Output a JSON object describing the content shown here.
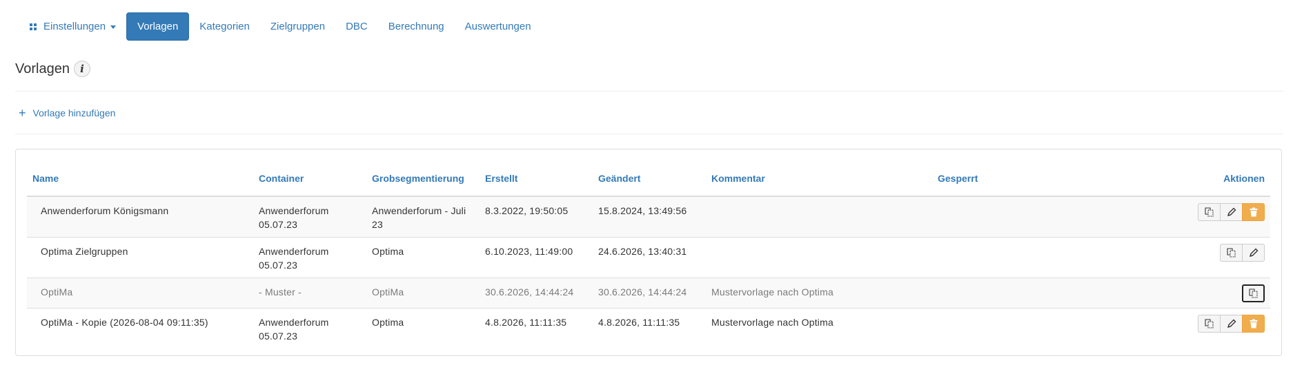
{
  "nav": {
    "settings_label": "Einstellungen",
    "tabs": [
      {
        "label": "Vorlagen",
        "active": true
      },
      {
        "label": "Kategorien",
        "active": false
      },
      {
        "label": "Zielgruppen",
        "active": false
      },
      {
        "label": "DBC",
        "active": false
      },
      {
        "label": "Berechnung",
        "active": false
      },
      {
        "label": "Auswertungen",
        "active": false
      }
    ]
  },
  "page": {
    "title": "Vorlagen",
    "info_glyph": "i",
    "add_label": "Vorlage hinzufügen",
    "add_glyph": "+"
  },
  "table": {
    "columns": [
      "Name",
      "Container",
      "Grobsegmentierung",
      "Erstellt",
      "Geändert",
      "Kommentar",
      "Gesperrt",
      "Aktionen"
    ],
    "rows": [
      {
        "name": "Anwenderforum Königsmann",
        "container": "Anwenderforum 05.07.23",
        "grobsegmentierung": "Anwenderforum - Juli 23",
        "erstellt": "8.3.2022, 19:50:05",
        "geaendert": "15.8.2024, 13:49:56",
        "kommentar": "",
        "gesperrt": "",
        "actions": [
          "copy",
          "edit",
          "delete"
        ]
      },
      {
        "name": "Optima Zielgruppen",
        "container": "Anwenderforum 05.07.23",
        "grobsegmentierung": "Optima",
        "erstellt": "6.10.2023, 11:49:00",
        "geaendert": "24.6.2026, 13:40:31",
        "kommentar": "",
        "gesperrt": "",
        "actions": [
          "copy",
          "edit"
        ]
      },
      {
        "name": "OptiMa",
        "container": "- Muster -",
        "grobsegmentierung": "OptiMa",
        "erstellt": "30.6.2026, 14:44:24",
        "geaendert": "30.6.2026, 14:44:24",
        "kommentar": "Mustervorlage nach Optima",
        "gesperrt": "",
        "actions": [
          "copy"
        ]
      },
      {
        "name": "OptiMa - Kopie (2026-08-04 09:11:35)",
        "container": "Anwenderforum 05.07.23",
        "grobsegmentierung": "Optima",
        "erstellt": "4.8.2026, 11:11:35",
        "geaendert": "4.8.2026, 11:11:35",
        "kommentar": "Mustervorlage nach Optima",
        "gesperrt": "",
        "actions": [
          "copy",
          "edit",
          "delete"
        ]
      }
    ]
  },
  "colors": {
    "link": "#337ab7",
    "active_tab_bg": "#337ab7",
    "delete_button": "#f0ad4e",
    "muted_text": "#7a7a7a"
  },
  "icons": {
    "settings": "grid-icon",
    "copy": "copy-icon",
    "edit": "pencil-icon",
    "delete": "trash-icon",
    "info": "info-icon"
  }
}
